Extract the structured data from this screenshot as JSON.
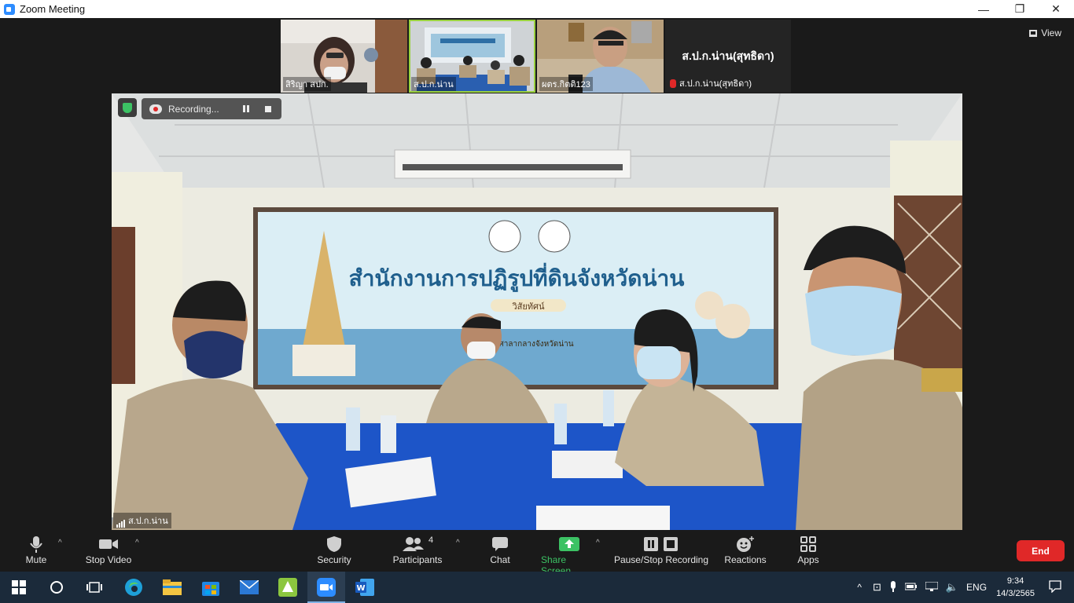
{
  "window": {
    "title": "Zoom Meeting",
    "controls": [
      "—",
      "❐",
      "✕"
    ]
  },
  "thumbnails": [
    {
      "name": "สิริญา สปก."
    },
    {
      "name": "ส.ป.ก.น่าน",
      "active": true
    },
    {
      "name": "ผตร.กิตติ123"
    }
  ],
  "name_tile": {
    "display_name": "ส.ป.ก.น่าน(สุทธิดา)",
    "label": "ส.ป.ก.น่าน(สุทธิดา)"
  },
  "view_button": "View",
  "recording": {
    "status": "Recording..."
  },
  "speaker": {
    "name": "ส.ป.ก.น่าน"
  },
  "banner": {
    "title": "สำนักงานการปฏิรูปที่ดินจังหวัดน่าน",
    "subtitle": "วิสัยทัศน์",
    "footer": "ศาลากลางจังหวัดน่าน"
  },
  "toolbar": {
    "mute": "Mute",
    "stop_video": "Stop Video",
    "security": "Security",
    "participants": "Participants",
    "participants_count": "4",
    "chat": "Chat",
    "share_screen": "Share Screen",
    "pause_stop_recording": "Pause/Stop Recording",
    "reactions": "Reactions",
    "apps": "Apps",
    "end": "End"
  },
  "taskbar": {
    "language": "ENG",
    "time": "9:34",
    "date": "14/3/2565"
  },
  "colors": {
    "accent_green": "#3cc264",
    "end_red": "#e02828",
    "toolbar_bg": "#1a1a1a",
    "taskbar_bg": "#1b2a3a"
  }
}
